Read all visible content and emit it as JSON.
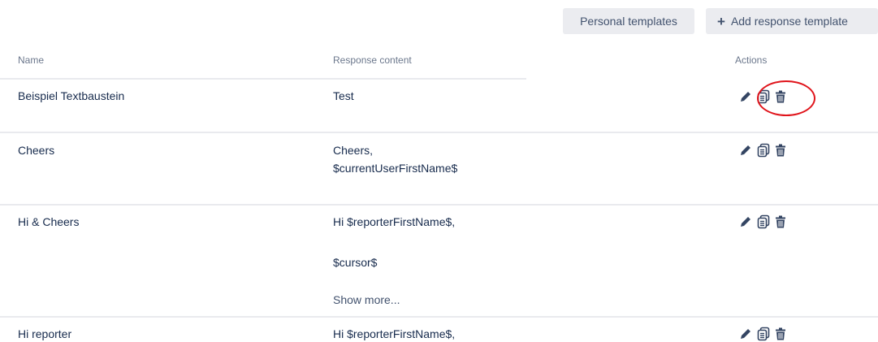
{
  "toolbar": {
    "personal_label": "Personal templates",
    "add_label": "Add response template"
  },
  "table": {
    "headers": {
      "name": "Name",
      "content": "Response content",
      "actions": "Actions"
    },
    "rows": [
      {
        "name": "Beispiel Textbaustein",
        "content": [
          "Test"
        ]
      },
      {
        "name": "Cheers",
        "content": [
          "Cheers,",
          "$currentUserFirstName$"
        ]
      },
      {
        "name": "Hi & Cheers",
        "content": [
          "Hi $reporterFirstName$,",
          "$cursor$"
        ],
        "show_more": "Show more..."
      },
      {
        "name": "Hi reporter",
        "content": [
          "Hi $reporterFirstName$,"
        ]
      }
    ]
  },
  "icons": {
    "edit": "pencil-icon",
    "copy": "copy-icon",
    "delete": "trash-icon"
  },
  "colors": {
    "icon": "#344563",
    "highlight": "#e0141b",
    "button_bg": "#ebecf0"
  }
}
